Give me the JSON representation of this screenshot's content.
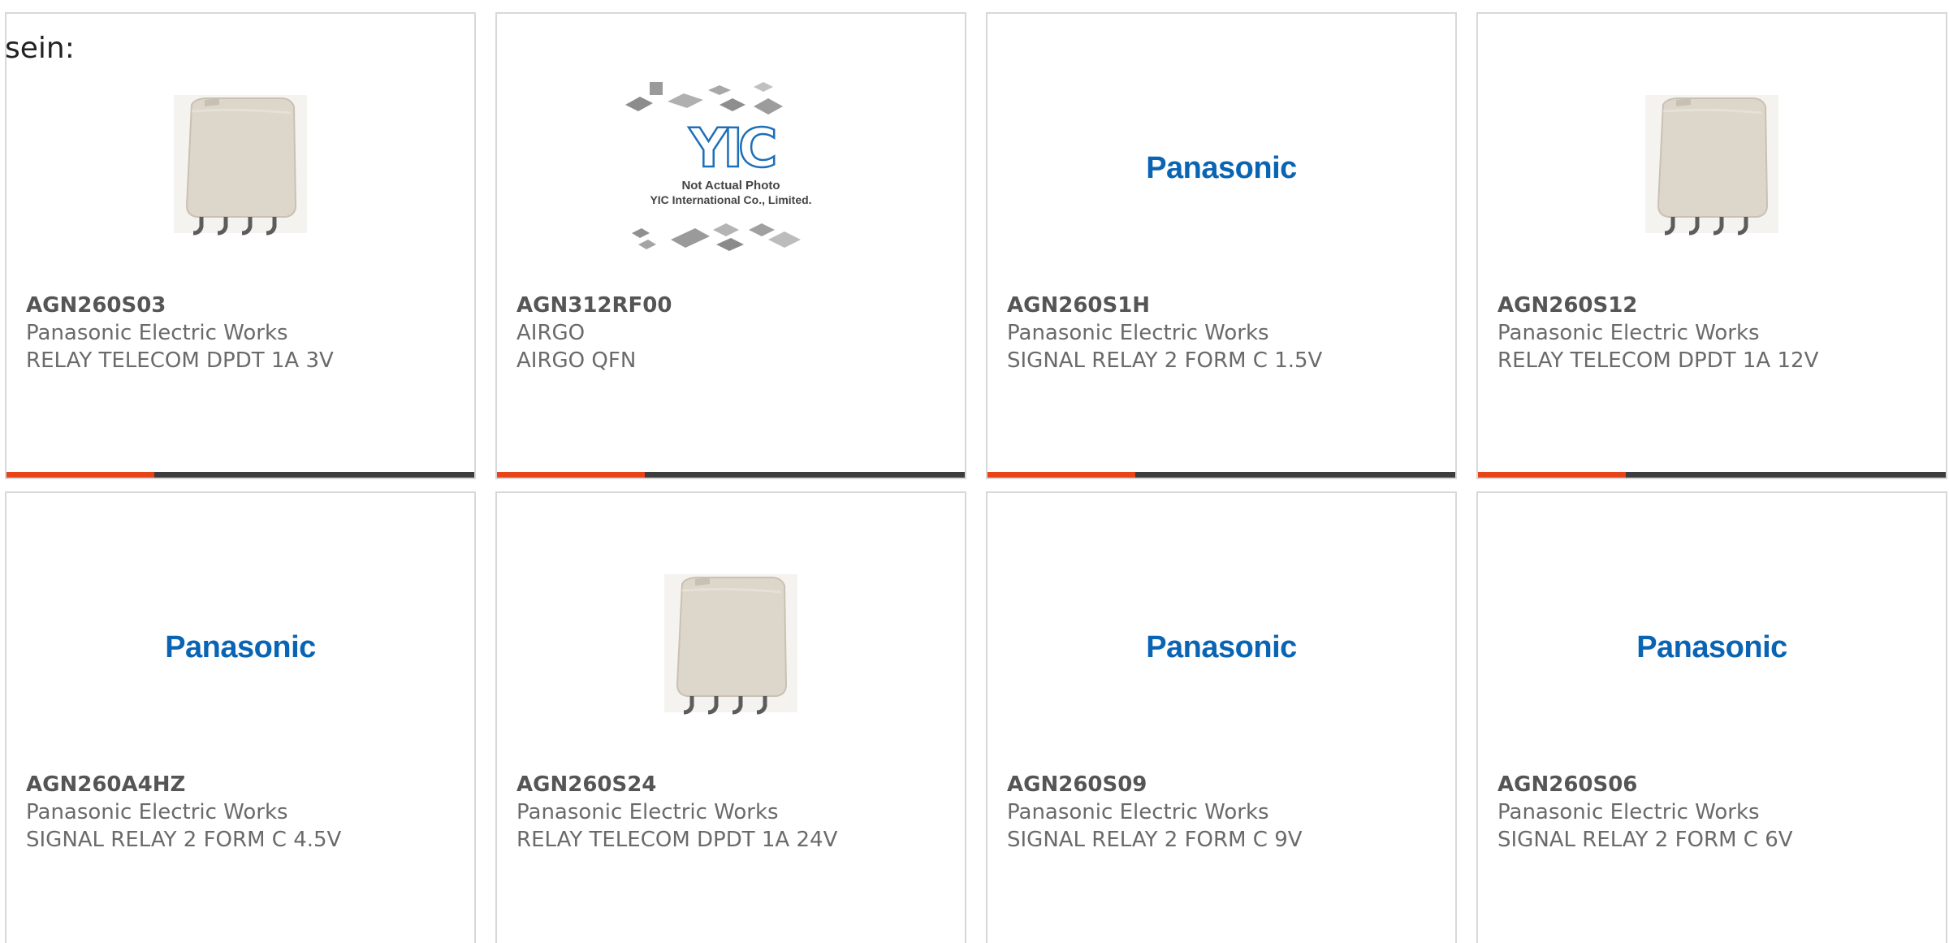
{
  "lead_text": "sein:",
  "colors": {
    "accent": "#e8441a",
    "bar": "#3d3d3d",
    "panasonic_blue": "#0a64b4",
    "yic_blue": "#1d6fb8"
  },
  "products": [
    {
      "part_number": "AGN260S03",
      "manufacturer": "Panasonic Electric Works",
      "description": "RELAY TELECOM DPDT 1A 3V",
      "image": "relay-photo"
    },
    {
      "part_number": "AGN312RF00",
      "manufacturer": "AIRGO",
      "description": "AIRGO QFN",
      "image": "yic-placeholder",
      "image_text": {
        "brand": "YIC",
        "line1": "Not Actual Photo",
        "line2": "YIC International Co., Limited."
      }
    },
    {
      "part_number": "AGN260S1H",
      "manufacturer": "Panasonic Electric Works",
      "description": "SIGNAL RELAY 2 FORM C 1.5V",
      "image": "panasonic-logo",
      "logo_text": "Panasonic"
    },
    {
      "part_number": "AGN260S12",
      "manufacturer": "Panasonic Electric Works",
      "description": "RELAY TELECOM DPDT 1A 12V",
      "image": "relay-photo"
    },
    {
      "part_number": "AGN260A4HZ",
      "manufacturer": "Panasonic Electric Works",
      "description": "SIGNAL RELAY 2 FORM C 4.5V",
      "image": "panasonic-logo",
      "logo_text": "Panasonic"
    },
    {
      "part_number": "AGN260S24",
      "manufacturer": "Panasonic Electric Works",
      "description": "RELAY TELECOM DPDT 1A 24V",
      "image": "relay-photo"
    },
    {
      "part_number": "AGN260S09",
      "manufacturer": "Panasonic Electric Works",
      "description": "SIGNAL RELAY 2 FORM C 9V",
      "image": "panasonic-logo",
      "logo_text": "Panasonic"
    },
    {
      "part_number": "AGN260S06",
      "manufacturer": "Panasonic Electric Works",
      "description": "SIGNAL RELAY 2 FORM C 6V",
      "image": "panasonic-logo",
      "logo_text": "Panasonic"
    }
  ]
}
